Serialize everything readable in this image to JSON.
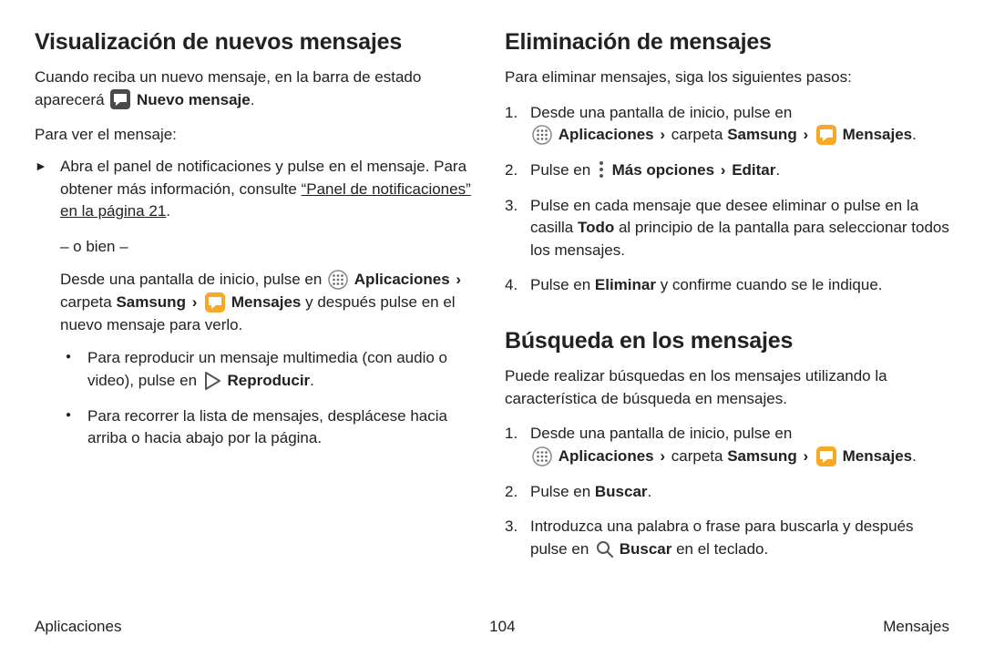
{
  "left": {
    "h1": "Visualización de nuevos mensajes",
    "intro_a": "Cuando reciba un nuevo mensaje, en la barra de estado aparecerá ",
    "intro_b": " Nuevo mensaje",
    "intro_c": ".",
    "lead": "Para ver el mensaje:",
    "tri1_a": "Abra el panel de notificaciones y pulse en el mensaje. Para obtener más información, consulte ",
    "tri1_link": "“Panel de notificaciones” en la página 21",
    "tri1_b": ".",
    "or": "– o bien –",
    "cont_a": "Desde una pantalla de inicio, pulse en ",
    "apps": "Aplicaciones",
    "samsung": "Samsung",
    "carpeta": " carpeta ",
    "mensajes": "Mensajes",
    "cont_b": " y después pulse en el nuevo mensaje para verlo.",
    "bul1_a": "Para reproducir un mensaje multimedia (con audio o video), pulse en ",
    "bul1_b": " Reproducir",
    "bul1_c": ".",
    "bul2": "Para recorrer la lista de mensajes, desplácese hacia arriba o hacia abajo por la página."
  },
  "right": {
    "h1": "Eliminación de mensajes",
    "intro": "Para eliminar mensajes, siga los siguientes pasos:",
    "s1": "Desde una pantalla de inicio, pulse en ",
    "apps": "Aplicaciones",
    "carpeta": " carpeta ",
    "samsung": "Samsung",
    "mensajes": "Mensajes",
    "s1_end": ".",
    "s2_a": "Pulse en ",
    "s2_b": " Más opciones",
    "s2_c": "Editar",
    "s2_d": ".",
    "s3_a": "Pulse en cada mensaje que desee eliminar o pulse en la casilla ",
    "s3_b": "Todo",
    "s3_c": " al principio de la pantalla para seleccionar todos los mensajes.",
    "s4_a": "Pulse en ",
    "s4_b": "Eliminar",
    "s4_c": " y confirme cuando se le indique.",
    "h2": "Búsqueda en los mensajes",
    "intro2": "Puede realizar búsquedas en los mensajes utilizando la característica de búsqueda en mensajes.",
    "b2_a": "Pulse en ",
    "b2_b": "Buscar",
    "b2_c": ".",
    "b3_a": "Introduzca una palabra o frase para buscarla y después pulse en ",
    "b3_b": " Buscar",
    "b3_c": " en el teclado."
  },
  "footer": {
    "left": "Aplicaciones",
    "center": "104",
    "right": "Mensajes"
  }
}
